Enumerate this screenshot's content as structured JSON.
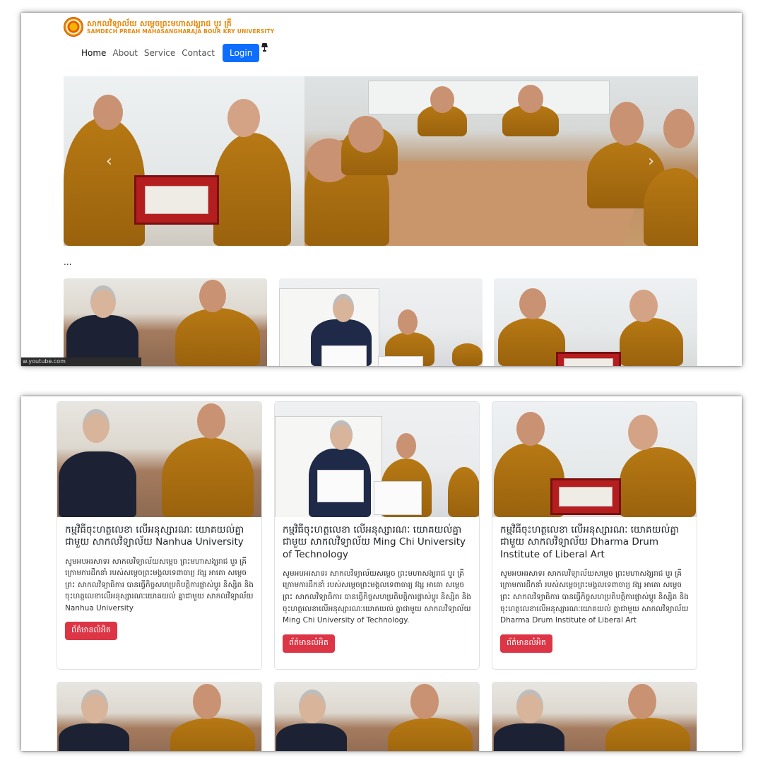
{
  "header": {
    "brand_khmer": "សាកលវិទ្យាល័យ សម្ដេចព្រះមហាសង្ឃរាជ បួរ គ្រី",
    "brand_english": "SAMDECH PREAH MAHASANGHARAJA BOUR KRY UNIVERSITY"
  },
  "nav": {
    "items": [
      "Home",
      "About",
      "Service",
      "Contact"
    ],
    "login": "Login"
  },
  "carousel": {
    "prev": "‹",
    "next": "›"
  },
  "ellipsis": "...",
  "youtube_label": "w.youtube.com",
  "cards": [
    {
      "title": "កម្មវិធីចុះហត្ថលេខា លើអនុស្សារណៈ យោគយល់គ្នាជាមួយ សាកលវិទ្យាល័យ Nanhua University",
      "text": "សូមអបអរសាទរ សាកលវិទ្យាល័យសម្ដេច ព្រះមហាសង្ឃរាជ បួរ គ្រី ក្រោមការដឹកនាំ របស់សម្ដេចព្រះមង្គលទេពាចារ្យ វង្ស អាគោ សម្ដេចព្រះ សាកលវិទ្យាធិការ បានធ្វើកិច្ចសហប្រតិបត្តិការផ្លាស់ប្ដូរ និស្សិត និងចុះហត្ថលេខាលើអនុស្សារណៈយោគយល់ គ្នាជាមួយ សាកលវិទ្យាល័យ Nanhua University",
      "button": "ព័ត៌មានលំអិត"
    },
    {
      "title": "កម្មវិធីចុះហត្ថលេខា លើអនុស្សារណៈ យោគយល់គ្នាជាមួយ សាកលវិទ្យាល័យ Ming Chi University of Technology",
      "text": "សូមអបអរសាទរ សាកលវិទ្យាល័យសម្ដេច ព្រះមហាសង្ឃរាជ បួរ គ្រី ក្រោមការដឹកនាំ របស់សម្ដេចព្រះមង្គលទេពាចារ្យ វង្ស អាគោ សម្ដេចព្រះ សាកលវិទ្យាធិការ បានធ្វើកិច្ចសហប្រតិបត្តិការផ្លាស់ប្ដូរ និស្សិត និងចុះហត្ថលេខាលើអនុស្សារណៈយោគយល់ គ្នាជាមួយ សាកលវិទ្យាល័យ Ming Chi University of Technology.",
      "button": "ព័ត៌មានលំអិត"
    },
    {
      "title": "កម្មវិធីចុះហត្ថលេខា លើអនុស្សារណៈ យោគយល់គ្នាជាមួយ សាកលវិទ្យាល័យ Dharma Drum Institute of Liberal Art",
      "text": "សូមអបអរសាទរ សាកលវិទ្យាល័យសម្ដេច ព្រះមហាសង្ឃរាជ បួរ គ្រី ក្រោមការដឹកនាំ របស់សម្ដេចព្រះមង្គលទេពាចារ្យ វង្ស អាគោ សម្ដេចព្រះ សាកលវិទ្យាធិការ បានធ្វើកិច្ចសហប្រតិបត្តិការផ្លាស់ប្ដូរ និស្សិត និងចុះហត្ថលេខាលើអនុស្សារណៈយោគយល់ គ្នាជាមួយ សាកលវិទ្យាល័យ Dharma Drum Institute of Liberal Art",
      "button": "ព័ត៌មានលំអិត"
    }
  ],
  "colors": {
    "login_blue": "#0d6efd",
    "details_red": "#dc3545",
    "brand_orange": "#e8870a",
    "robe_saffron": "#b77914"
  },
  "icons": {
    "lamp": "lamp-icon",
    "prev": "chevron-left-icon",
    "next": "chevron-right-icon",
    "seal": "university-seal-logo"
  }
}
